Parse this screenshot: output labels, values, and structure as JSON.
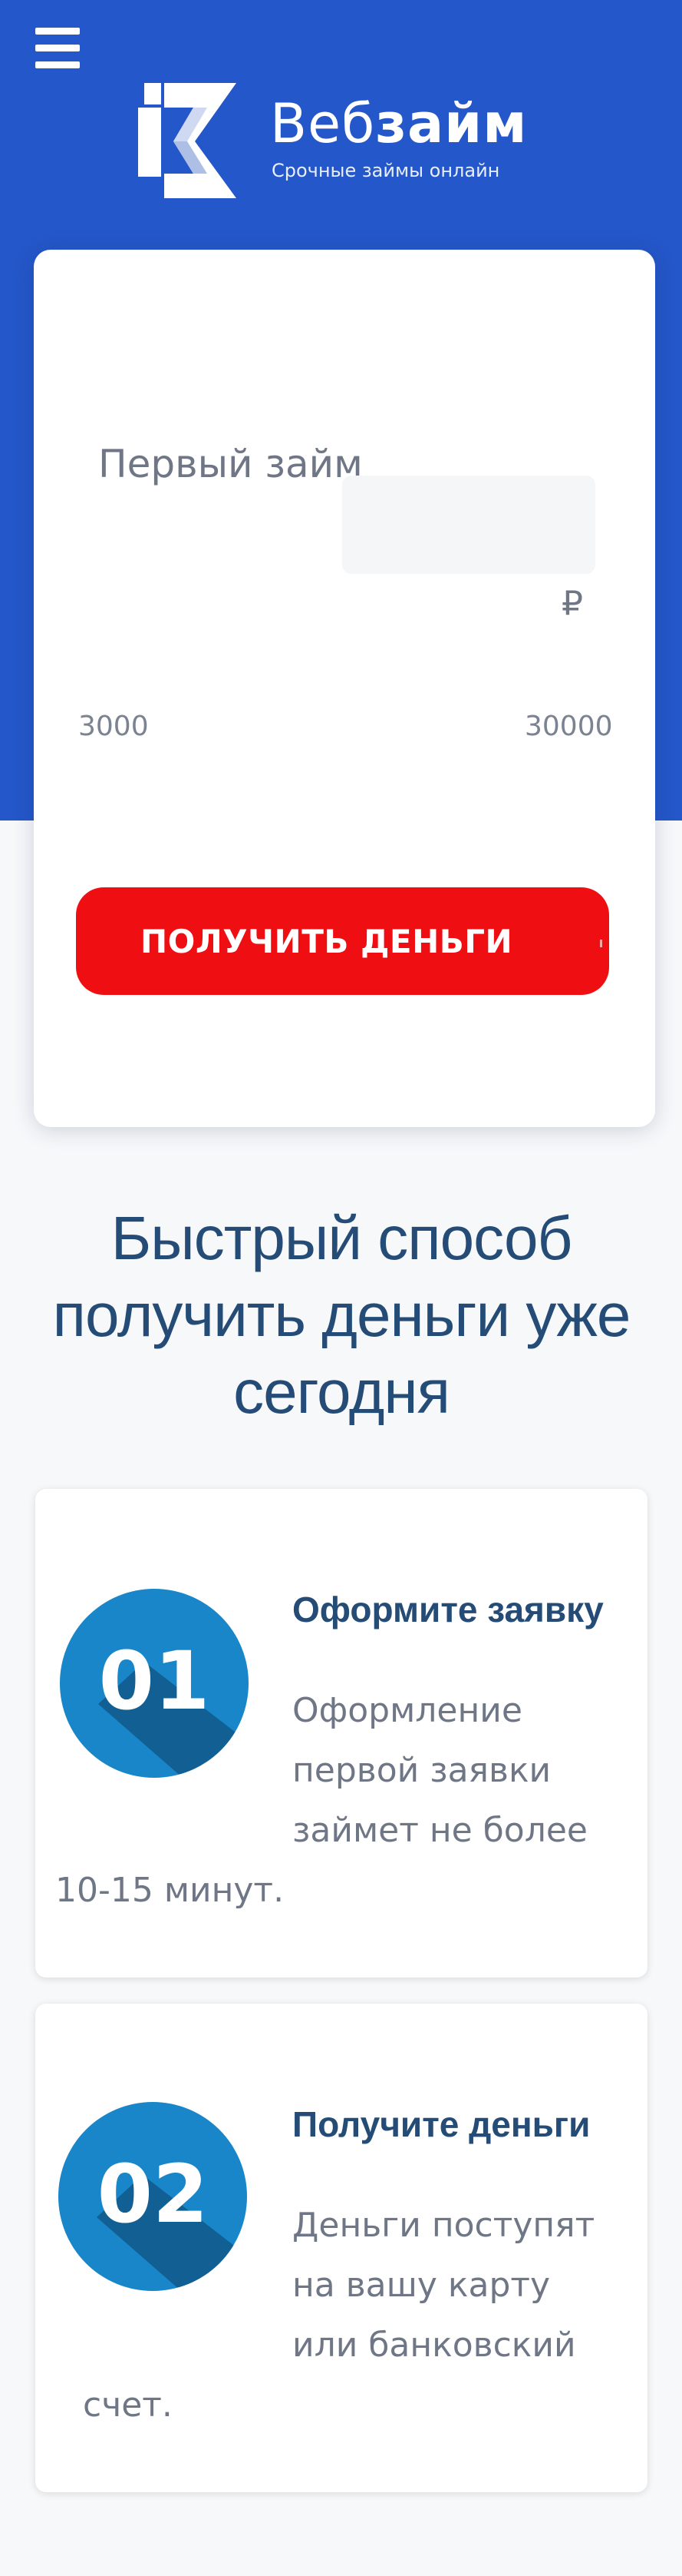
{
  "header": {
    "menu_icon": "hamburger-menu-icon",
    "brand_regular": "Веб",
    "brand_bold": "займ",
    "tagline": "Срочные займы онлайн",
    "brand_color": "#2457c9"
  },
  "calculator": {
    "label": "Первый займ",
    "amount_value": "",
    "currency": "₽",
    "min": "3000",
    "max": "30000",
    "submit_label": "ПОЛУЧИТЬ ДЕНЬГИ",
    "submit_color": "#ef0f13"
  },
  "section": {
    "heading_line1": "Быстрый способ",
    "heading_line2": "получить деньги уже",
    "heading_line3": "сегодня"
  },
  "steps": [
    {
      "number": "01",
      "title": "Оформите заявку",
      "text_lines": [
        "Оформление",
        "первой заявки",
        "займет не более",
        "10-15 минут."
      ]
    },
    {
      "number": "02",
      "title": "Получите деньги",
      "text_lines": [
        "Деньги поступят",
        "на вашу карту",
        "или банковский",
        "счет."
      ]
    }
  ]
}
